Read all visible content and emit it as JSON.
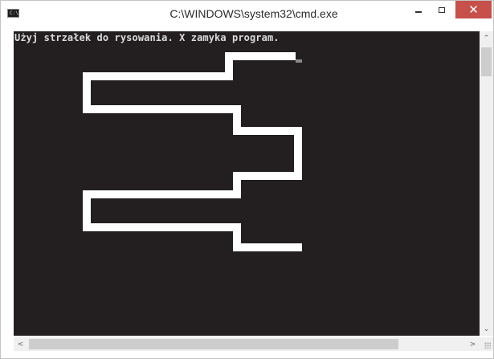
{
  "window": {
    "title": "C:\\WINDOWS\\system32\\cmd.exe",
    "app_icon_text": "C:\\",
    "controls": {
      "minimize_icon": "minimize-icon",
      "maximize_icon": "maximize-icon",
      "close_icon": "close-icon",
      "close_glyph": "✕",
      "close_color": "#c7504b"
    }
  },
  "console": {
    "background": "#231f20",
    "text_color": "#dcdcdc",
    "lines": [
      "Użyj strzałek do rysowania. X zamyka program."
    ],
    "drawing_color": "#ffffff"
  },
  "scrollbars": {
    "vertical": {
      "up_glyph": "⌃",
      "down_glyph": "⌄"
    },
    "horizontal": {
      "left_glyph": "<",
      "right_glyph": ">"
    }
  }
}
